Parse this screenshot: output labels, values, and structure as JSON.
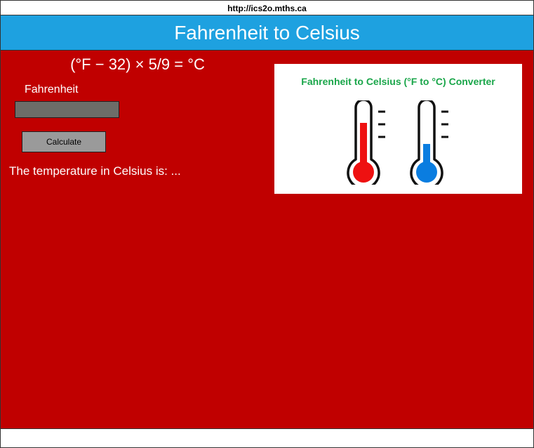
{
  "url": "http://ics2o.mths.ca",
  "header": {
    "title": "Fahrenheit to Celsius"
  },
  "form": {
    "formula": "(°F − 32) × 5/9 = °C",
    "fahrenheit_label": "Fahrenheit",
    "fahrenheit_value": "",
    "calculate_label": "Calculate",
    "result_text": "The temperature in Celsius is: ..."
  },
  "illustration": {
    "title": "Fahrenheit to Celsius (°F to °C) Converter",
    "hot_color": "#ee1111",
    "cold_color": "#0a7de0"
  },
  "colors": {
    "header_bg": "#1ea1e0",
    "main_bg": "#c00000",
    "input_bg": "#6d6d68",
    "button_bg": "#9a9a9a",
    "title_green": "#1aa64a"
  }
}
